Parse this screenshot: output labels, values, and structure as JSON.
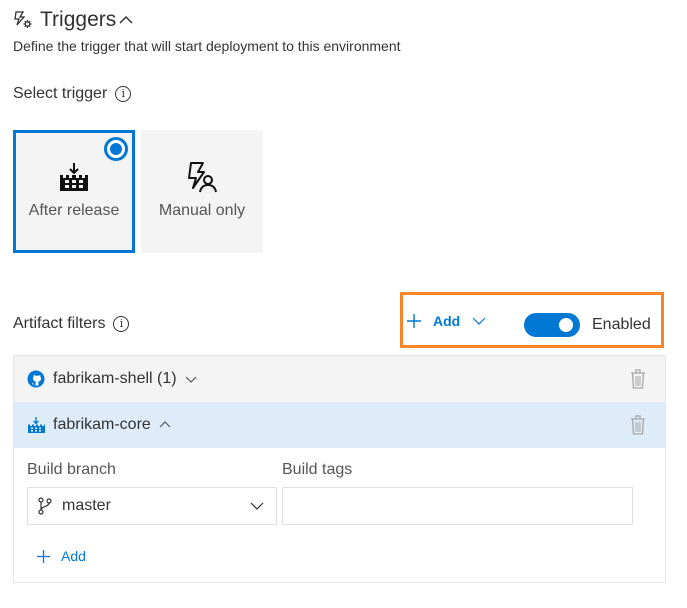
{
  "header": {
    "title": "Triggers",
    "description": "Define the trigger that will start deployment to this environment"
  },
  "select_trigger": {
    "label": "Select trigger",
    "info_glyph": "i",
    "options": [
      {
        "label": "After release",
        "icon": "build-release-icon",
        "selected": true
      },
      {
        "label": "Manual only",
        "icon": "lightning-person-icon",
        "selected": false
      }
    ]
  },
  "artifact_filters": {
    "label": "Artifact filters",
    "info_glyph": "i",
    "add_label": "Add",
    "toggle_label": "Enabled",
    "toggle_on": true,
    "highlight_color": "#f7862a",
    "accent_color": "#0078d4",
    "items": [
      {
        "name": "fabrikam-shell",
        "count": "(1)",
        "icon": "github-icon",
        "expanded": false
      },
      {
        "name": "fabrikam-core",
        "count": "",
        "icon": "build-icon",
        "expanded": true
      }
    ],
    "detail": {
      "branch_label": "Build branch",
      "branch_value": "master",
      "tags_label": "Build tags",
      "tags_value": "",
      "add_label": "Add"
    }
  }
}
